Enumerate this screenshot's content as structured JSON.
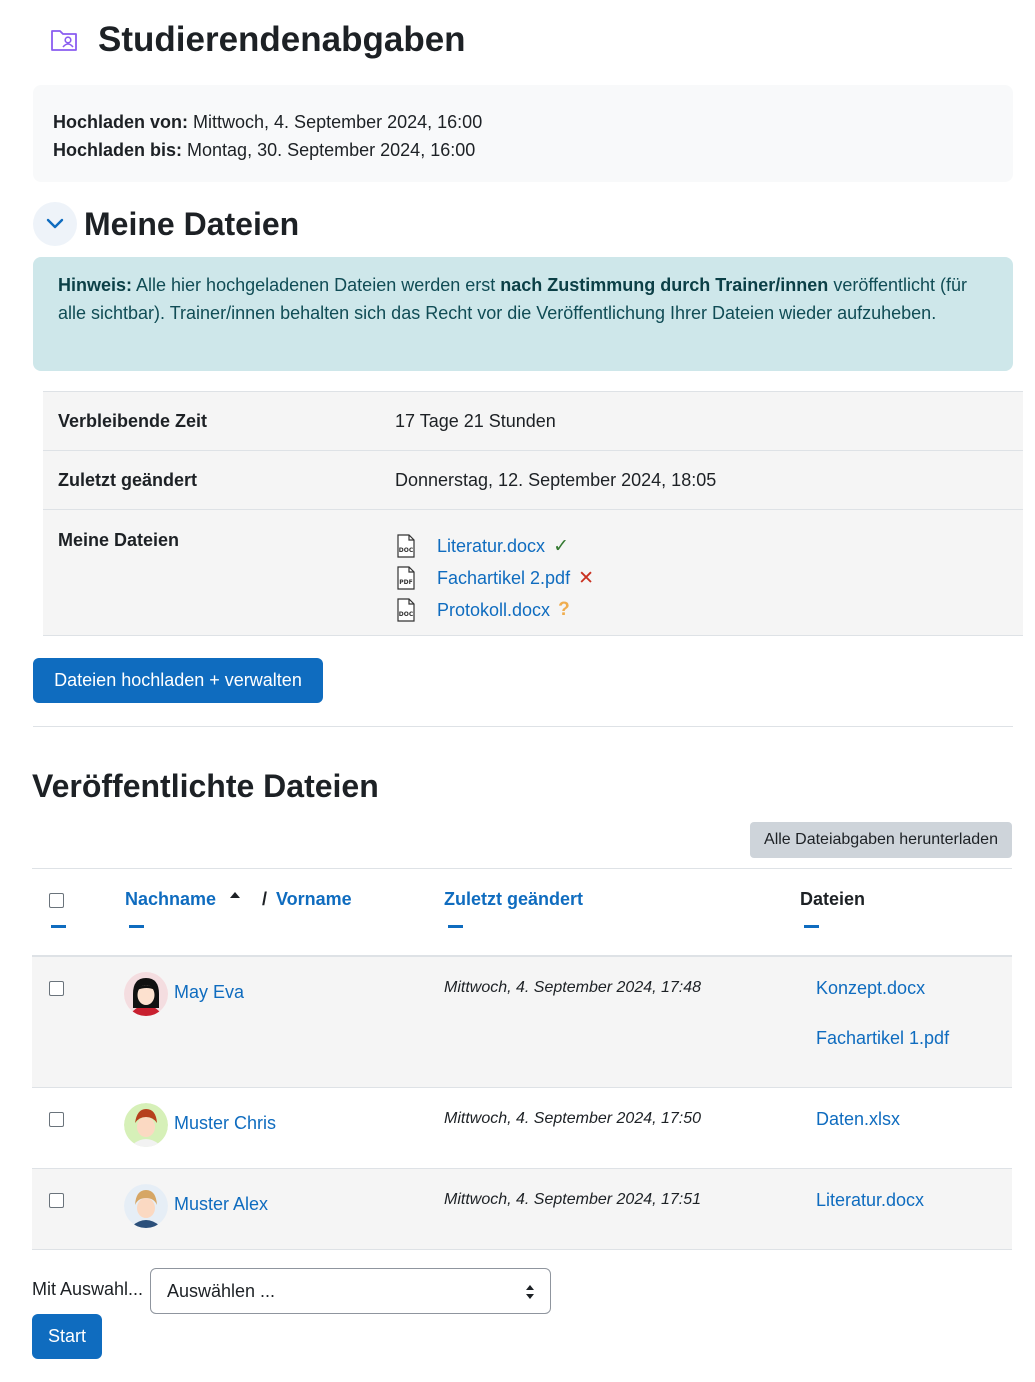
{
  "header": {
    "title": "Studierendenabgaben",
    "icon": "folder-user-icon"
  },
  "dates": {
    "from_label": "Hochladen von:",
    "from_value": "Mittwoch, 4. September 2024, 16:00",
    "until_label": "Hochladen bis:",
    "until_value": "Montag, 30. September 2024, 16:00"
  },
  "my_files_section": {
    "title": "Meine Dateien",
    "notice": {
      "prefix_bold": "Hinweis:",
      "text1": " Alle hier hochgeladenen Dateien werden erst ",
      "bold_mid": "nach Zustimmung durch Trainer/innen",
      "text2": " veröffentlicht (für alle sichtbar). Trainer/innen behalten sich das Recht vor die Veröffentlichung Ihrer Dateien wieder aufzuheben."
    },
    "rows": {
      "remaining_label": "Verbleibende Zeit",
      "remaining_value": "17 Tage 21 Stunden",
      "modified_label": "Zuletzt geändert",
      "modified_value": "Donnerstag, 12. September 2024, 18:05",
      "files_label": "Meine Dateien"
    },
    "files": [
      {
        "name": "Literatur.docx",
        "type": "DOC",
        "status": "approved",
        "status_symbol": "✓",
        "status_color": "#357a32"
      },
      {
        "name": "Fachartikel 2.pdf",
        "type": "PDF",
        "status": "rejected",
        "status_symbol": "✕",
        "status_color": "#ca3120"
      },
      {
        "name": "Protokoll.docx",
        "type": "DOC",
        "status": "pending",
        "status_symbol": "?",
        "status_color": "#f0ad4e"
      }
    ],
    "upload_button": "Dateien hochladen + verwalten"
  },
  "published_section": {
    "title": "Veröffentlichte Dateien",
    "download_all_button": "Alle Dateiabgaben herunterladen",
    "columns": {
      "lastname": "Nachname",
      "separator": "/",
      "firstname": "Vorname",
      "modified": "Zuletzt geändert",
      "files": "Dateien"
    },
    "rows": [
      {
        "name": "May Eva",
        "date": "Mittwoch, 4. September 2024, 17:48",
        "files": [
          "Konzept.docx",
          "Fachartikel 1.pdf"
        ]
      },
      {
        "name": "Muster Chris",
        "date": "Mittwoch, 4. September 2024, 17:50",
        "files": [
          "Daten.xlsx"
        ]
      },
      {
        "name": "Muster Alex",
        "date": "Mittwoch, 4. September 2024, 17:51",
        "files": [
          "Literatur.docx"
        ]
      }
    ]
  },
  "bulk": {
    "label": "Mit Auswahl...",
    "select_value": "Auswählen ...",
    "start_button": "Start"
  },
  "colors": {
    "primary": "#0f6cbf",
    "notice_bg": "#cee7ea",
    "icon_purple": "#8a5cf0"
  }
}
